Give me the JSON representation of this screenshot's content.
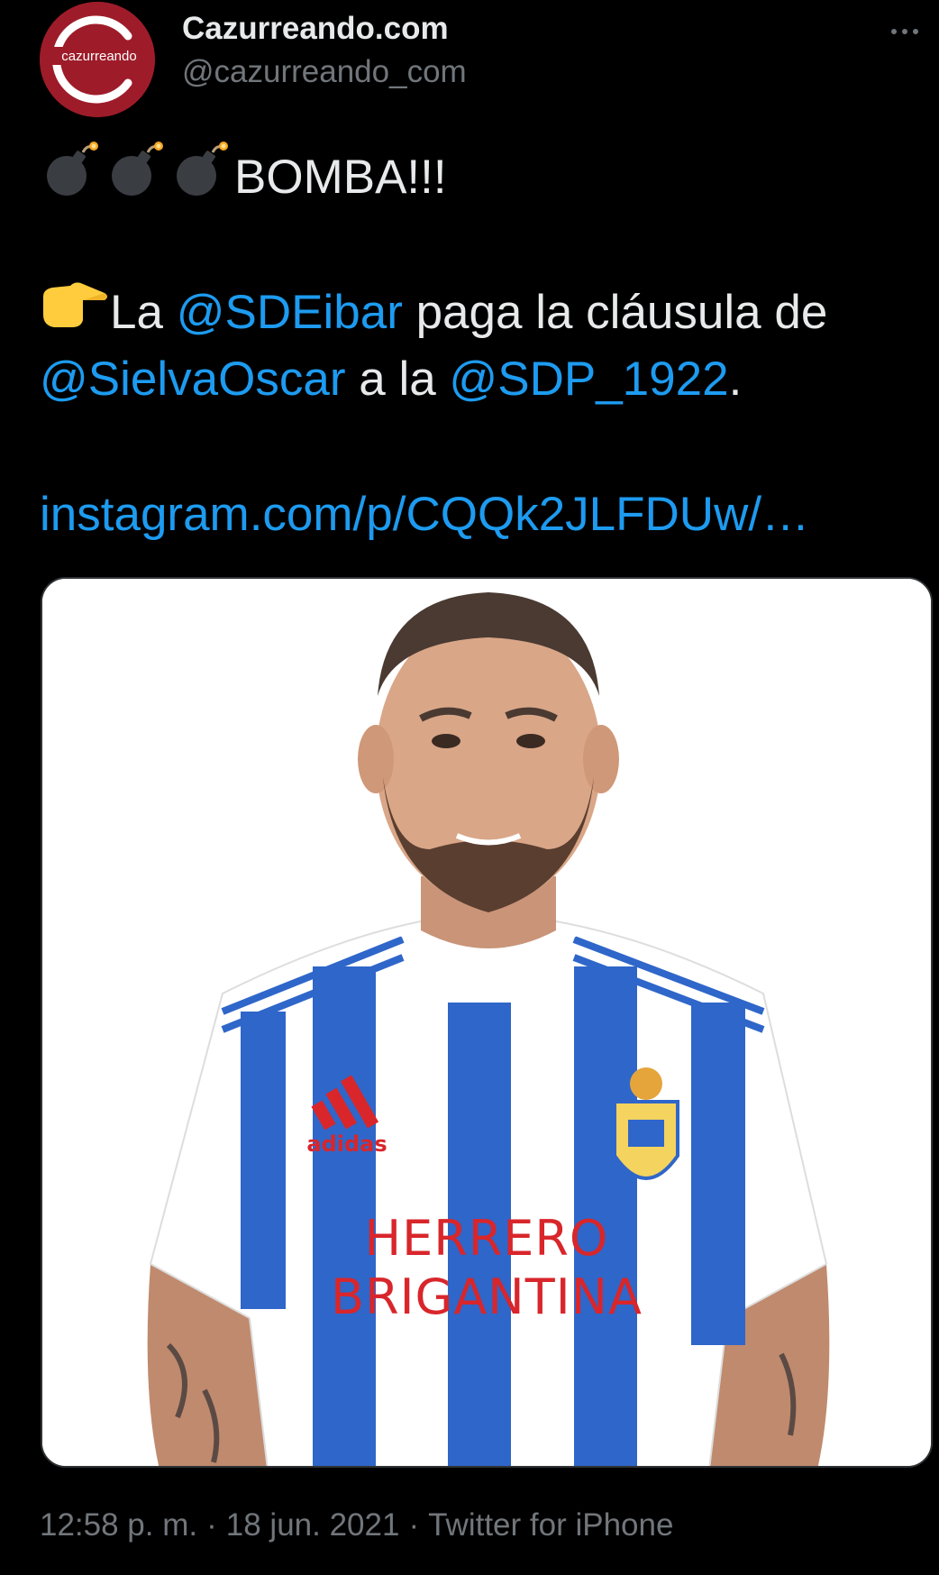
{
  "author": {
    "display_name": "Cazurreando.com",
    "handle": "@cazurreando_com",
    "avatar_label": "cazurreando",
    "avatar_color": "#9e1c2a"
  },
  "header": {
    "more_icon": "more-horizontal-icon"
  },
  "tweet": {
    "line1_text": "BOMBA!!!",
    "line1_emoji": [
      "bomb-icon",
      "bomb-icon",
      "bomb-icon"
    ],
    "pointer_emoji": "backhand-index-pointing-right-icon",
    "line2_prefix": "La ",
    "mention_1": "@SDEibar",
    "line2_suffix": " paga la cláusula de",
    "mention_2": "@SielvaOscar",
    "line3_middle": " a la ",
    "mention_3": "@SDP_1922",
    "line3_end": ".",
    "link": "instagram.com/p/CQQk2JLFDUw/…"
  },
  "media": {
    "jersey_brand": "adidas",
    "sponsor_line1": "HERRERO",
    "sponsor_line2": "BRIGANTINA"
  },
  "meta": {
    "time": "12:58 p. m.",
    "date": "18 jun. 2021",
    "source": "Twitter for iPhone",
    "separator": "·"
  },
  "colors": {
    "background": "#000000",
    "text": "#e7e9ea",
    "secondary": "#71767b",
    "link": "#1d9bf0"
  }
}
